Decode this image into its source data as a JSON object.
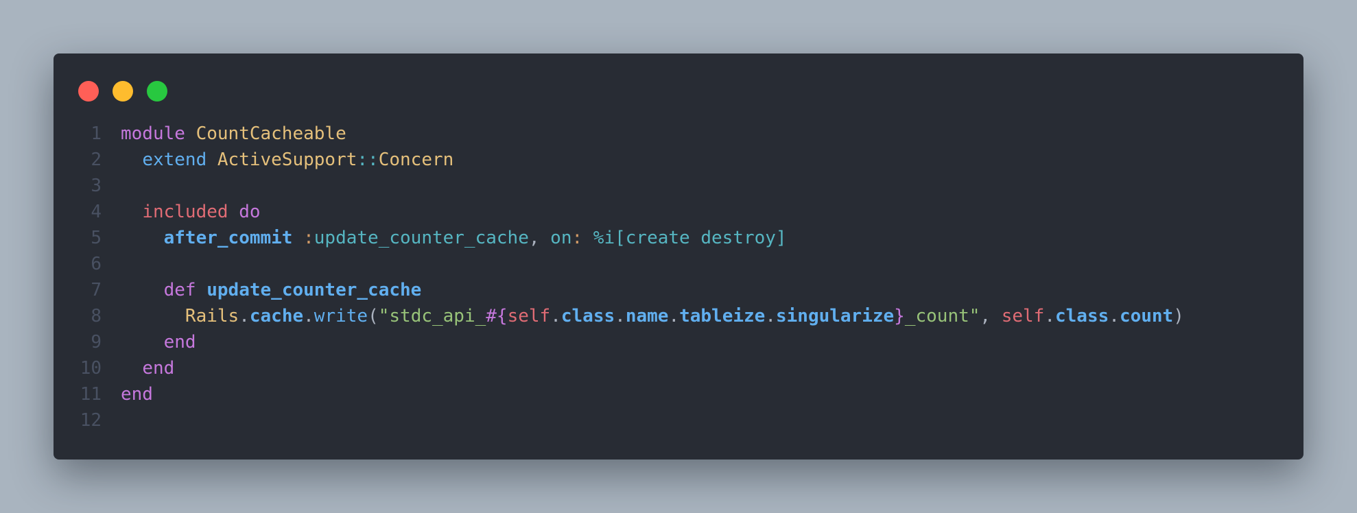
{
  "window": {
    "traffic_lights": [
      {
        "name": "close",
        "color": "#ff5f57"
      },
      {
        "name": "minimize",
        "color": "#febc2e"
      },
      {
        "name": "zoom",
        "color": "#28c840"
      }
    ]
  },
  "colors": {
    "keyword": "#c678dd",
    "const": "#e5c07b",
    "func": "#61afef",
    "red": "#e06c75",
    "cyan": "#56b6c2",
    "string": "#98c379",
    "orange": "#d19a66",
    "plain": "#abb2bf"
  },
  "lines": [
    {
      "n": "1",
      "tokens": [
        {
          "t": "module ",
          "c": "keyword"
        },
        {
          "t": "CountCacheable",
          "c": "const"
        }
      ]
    },
    {
      "n": "2",
      "tokens": [
        {
          "t": "  "
        },
        {
          "t": "extend ",
          "c": "func"
        },
        {
          "t": "ActiveSupport",
          "c": "const"
        },
        {
          "t": "::",
          "c": "cyan"
        },
        {
          "t": "Concern",
          "c": "const"
        }
      ]
    },
    {
      "n": "3",
      "tokens": []
    },
    {
      "n": "4",
      "tokens": [
        {
          "t": "  "
        },
        {
          "t": "included ",
          "c": "red"
        },
        {
          "t": "do",
          "c": "keyword"
        }
      ]
    },
    {
      "n": "5",
      "tokens": [
        {
          "t": "    "
        },
        {
          "t": "after_commit",
          "c": "func",
          "b": true
        },
        {
          "t": " "
        },
        {
          "t": ":",
          "c": "orange"
        },
        {
          "t": "update_counter_cache",
          "c": "cyan"
        },
        {
          "t": ", ",
          "c": "plain"
        },
        {
          "t": "on",
          "c": "cyan"
        },
        {
          "t": ": ",
          "c": "orange"
        },
        {
          "t": "%i[create destroy]",
          "c": "cyan"
        }
      ]
    },
    {
      "n": "6",
      "tokens": []
    },
    {
      "n": "7",
      "tokens": [
        {
          "t": "    "
        },
        {
          "t": "def ",
          "c": "keyword"
        },
        {
          "t": "update_counter_cache",
          "c": "func",
          "b": true
        }
      ]
    },
    {
      "n": "8",
      "tokens": [
        {
          "t": "      "
        },
        {
          "t": "Rails",
          "c": "const"
        },
        {
          "t": ".",
          "c": "plain"
        },
        {
          "t": "cache",
          "c": "func",
          "b": true
        },
        {
          "t": ".",
          "c": "plain"
        },
        {
          "t": "write",
          "c": "func"
        },
        {
          "t": "(",
          "c": "plain"
        },
        {
          "t": "\"stdc_api_",
          "c": "string"
        },
        {
          "t": "#{",
          "c": "keyword"
        },
        {
          "t": "self",
          "c": "red"
        },
        {
          "t": ".",
          "c": "plain"
        },
        {
          "t": "class",
          "c": "func",
          "b": true
        },
        {
          "t": ".",
          "c": "plain"
        },
        {
          "t": "name",
          "c": "func",
          "b": true
        },
        {
          "t": ".",
          "c": "plain"
        },
        {
          "t": "tableize",
          "c": "func",
          "b": true
        },
        {
          "t": ".",
          "c": "plain"
        },
        {
          "t": "singularize",
          "c": "func",
          "b": true
        },
        {
          "t": "}",
          "c": "keyword"
        },
        {
          "t": "_count\"",
          "c": "string"
        },
        {
          "t": ", ",
          "c": "plain"
        },
        {
          "t": "self",
          "c": "red"
        },
        {
          "t": ".",
          "c": "plain"
        },
        {
          "t": "class",
          "c": "func",
          "b": true
        },
        {
          "t": ".",
          "c": "plain"
        },
        {
          "t": "count",
          "c": "func",
          "b": true
        },
        {
          "t": ")",
          "c": "plain"
        }
      ]
    },
    {
      "n": "9",
      "tokens": [
        {
          "t": "    "
        },
        {
          "t": "end",
          "c": "keyword"
        }
      ]
    },
    {
      "n": "10",
      "tokens": [
        {
          "t": "  "
        },
        {
          "t": "end",
          "c": "keyword"
        }
      ]
    },
    {
      "n": "11",
      "tokens": [
        {
          "t": "end",
          "c": "keyword"
        }
      ]
    },
    {
      "n": "12",
      "tokens": []
    }
  ]
}
